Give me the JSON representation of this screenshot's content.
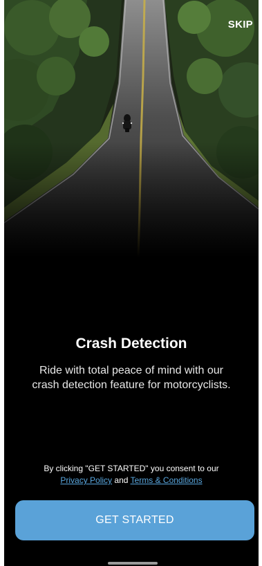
{
  "header": {
    "skip_label": "SKIP"
  },
  "onboarding": {
    "title": "Crash Detection",
    "description": "Ride with total peace of mind with our crash detection feature for motorcyclists."
  },
  "consent": {
    "prefix": "By clicking \"GET STARTED\" you consent to our",
    "privacy_label": "Privacy Policy",
    "connector": "and",
    "terms_label": "Terms & Conditions"
  },
  "actions": {
    "get_started_label": "GET STARTED"
  },
  "colors": {
    "background": "#000000",
    "accent": "#5aa2d8",
    "link": "#5aa8e0"
  }
}
